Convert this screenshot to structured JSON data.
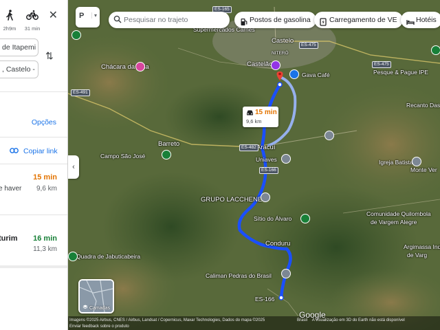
{
  "panel": {
    "modes": [
      {
        "name": "walk",
        "time": "2h9m"
      },
      {
        "name": "bike",
        "time": "31 min"
      }
    ],
    "origin_value": "de Itapemi",
    "destination_value": ", Castelo -",
    "options_label": "Opções",
    "copy_link_label": "Copiar link",
    "routes": [
      {
        "label": "e haver",
        "duration": "15 min",
        "distance": "9,6 km",
        "duration_color": "#e37400"
      },
      {
        "label": "turim",
        "duration": "16 min",
        "distance": "11,3 km",
        "duration_color": "#188038"
      }
    ]
  },
  "search": {
    "placeholder": "Pesquisar no trajeto"
  },
  "chips": [
    {
      "label": "Postos de gasolina",
      "icon": "gas-station-icon"
    },
    {
      "label": "Carregamento de VE",
      "icon": "ev-charging-icon"
    },
    {
      "label": "Hotéis",
      "icon": "hotel-icon"
    }
  ],
  "callout": {
    "duration": "15 min",
    "distance": "9,6 km"
  },
  "layers_label": "Camadas",
  "places": {
    "supermercados": "Supermercados Carnes",
    "castelo": "Castelo",
    "nitero": "NITERÓ",
    "castelao": "Castelão",
    "gava_cafe": "Gava Café",
    "chacara_tuia": "Chácara da Tuia",
    "pesque_pague": "Pesque & Pague IPE",
    "recanto": "Recanto Das Ar",
    "barreto": "Barreto",
    "campo_sao_jose": "Campo São José",
    "aracui": "Aracuí",
    "uniaves": "Uniaves",
    "igreja_batista": "Igreja Batista c",
    "monte_ver": "Monte Ver",
    "grupo_lacchene": "GRUPO LACCHENE",
    "sitio_alvaro": "Sítio do Álvaro",
    "comunidade": "Comunidade Quilombola",
    "vargem_alegre": "de Vargem Alegre",
    "conduru": "Conduru",
    "argimassa": "Argimassa Indús",
    "de_vargem": "de Varg",
    "quadra": "Quadra de Jabuticabeira",
    "caliman": "Caliman Pedras do Brasil",
    "es166_bottom": "ES-166"
  },
  "shields": {
    "es165": "ES-165",
    "es475": "ES-475",
    "es491": "ES-491",
    "es482": "ES-482",
    "es166": "ES-166",
    "es475b": "ES-475"
  },
  "footer": {
    "google": "Google",
    "attribution": "Imagens ©2025 Airbus, CNES / Airbus, Landsat / Copernicus, Maxar Technologies, Dados do mapa ©2025",
    "country": "Brasil",
    "earth_note": "A visualização em 3D do Earth não está disponível",
    "feedback": "Enviar feedback sobre o produto"
  },
  "colors": {
    "route_primary": "#1a4fff",
    "route_alt": "#9ab4f7",
    "duration_orange": "#e37400",
    "duration_green": "#188038",
    "link_blue": "#1a73e8",
    "destination_pin": "#ea4335"
  }
}
